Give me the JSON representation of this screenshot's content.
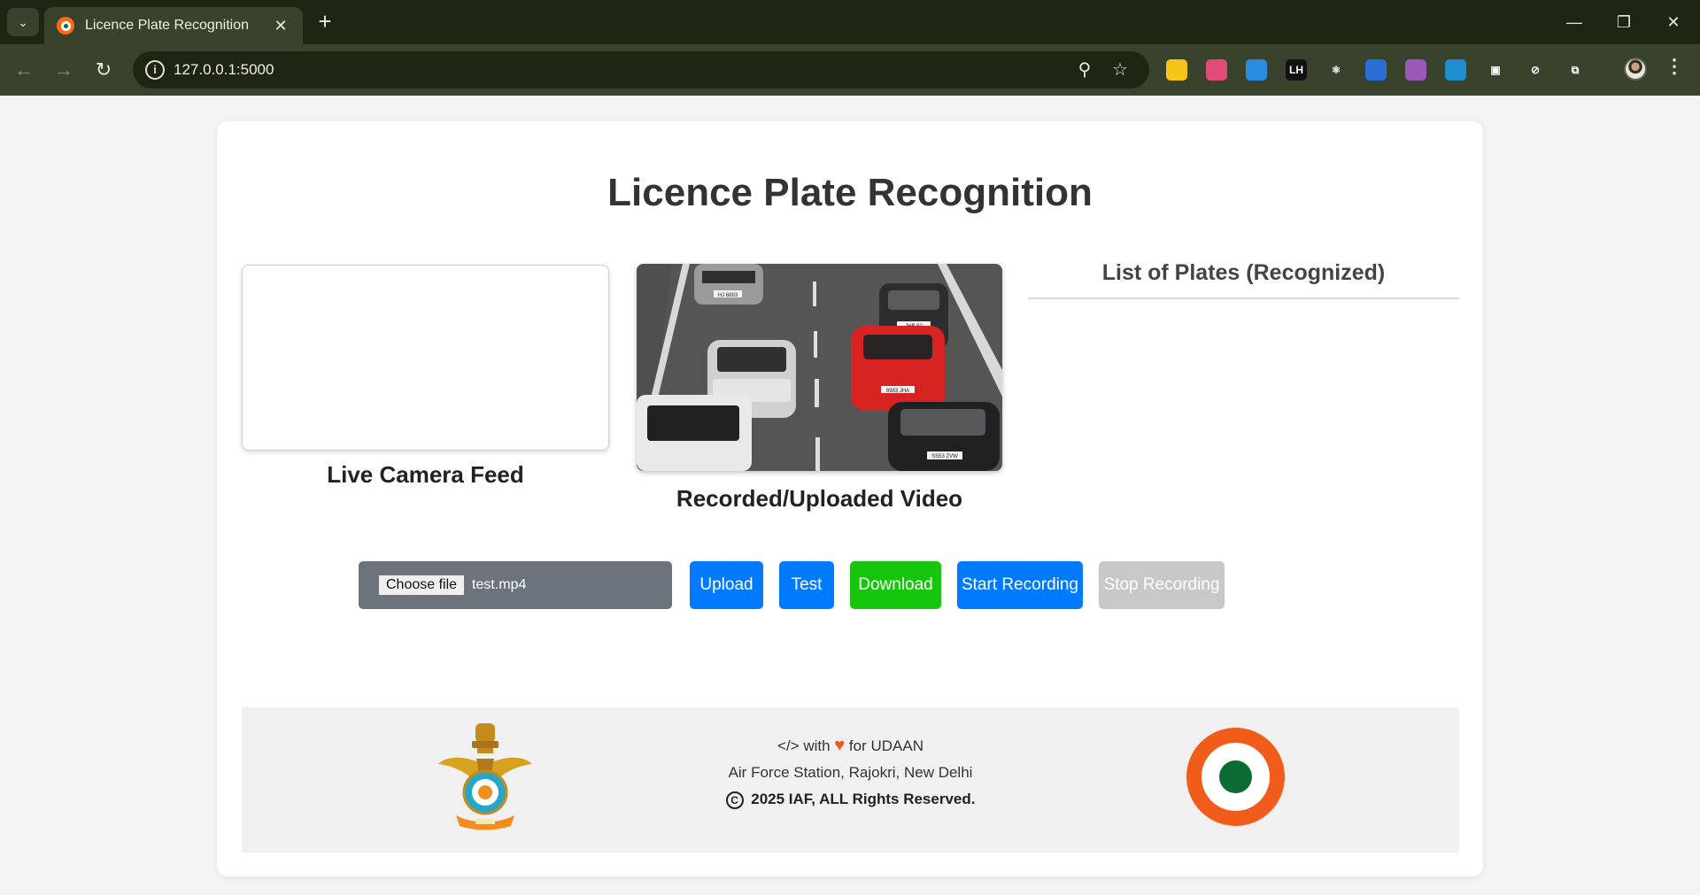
{
  "browser": {
    "tab_title": "Licence Plate Recognition",
    "url": "127.0.0.1:5000",
    "extensions": [
      {
        "icon": "yellow-note-icon",
        "color": "#f5c518",
        "text": ""
      },
      {
        "icon": "color-brain-icon",
        "color": "#e24a7a",
        "text": ""
      },
      {
        "icon": "diamond-icon",
        "color": "#2b8de0",
        "text": ""
      },
      {
        "icon": "lighthouse-icon",
        "color": "#111111",
        "text": "LH"
      },
      {
        "icon": "react-atom-icon",
        "color": "#38422c",
        "text": "⚛"
      },
      {
        "icon": "blue-ring-icon",
        "color": "#2a6fd6",
        "text": ""
      },
      {
        "icon": "colorful-flower-icon",
        "color": "#9b59b6",
        "text": ""
      },
      {
        "icon": "screen-capture-icon",
        "color": "#1f8ecf",
        "text": ""
      },
      {
        "icon": "window-icon",
        "color": "#38422c",
        "text": "▣"
      },
      {
        "icon": "compass-icon",
        "color": "#38422c",
        "text": "⊘"
      },
      {
        "icon": "puzzle-extensions-icon",
        "color": "#38422c",
        "text": "⧉"
      }
    ]
  },
  "page": {
    "title": "Licence Plate Recognition",
    "live_label": "Live Camera Feed",
    "video_label": "Recorded/Uploaded Video",
    "plates_title": "List of Plates (Recognized)",
    "plates": []
  },
  "controls": {
    "choose_file": "Choose file",
    "file_name": "test.mp4",
    "upload": "Upload",
    "test": "Test",
    "download": "Download",
    "start_recording": "Start Recording",
    "stop_recording": "Stop Recording",
    "colors": {
      "primary": "#007bff",
      "success": "#16c60c",
      "disabled": "#c8c8c8",
      "file_bg": "#6c737c"
    }
  },
  "video_scene": {
    "plates": [
      "HJ 6883",
      "JHB 82",
      "6983 JHA",
      "SS53 ZVW"
    ]
  },
  "footer": {
    "made_prefix": "</> with",
    "made_suffix": "for UDAAN",
    "location": "Air Force Station, Rajokri, New Delhi",
    "copyright": "2025 IAF, ALL Rights Reserved.",
    "copyright_symbol": "C"
  }
}
